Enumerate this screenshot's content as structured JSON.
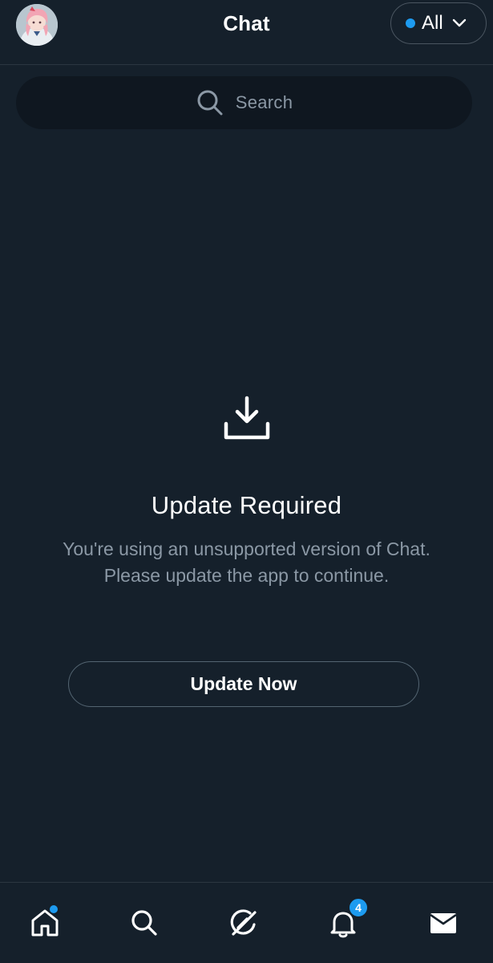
{
  "header": {
    "title": "Chat",
    "filter_label": "All"
  },
  "search": {
    "placeholder": "Search"
  },
  "empty_state": {
    "title": "Update Required",
    "body": "You're using an unsupported version of Chat. Please update the app to continue.",
    "button_label": "Update Now"
  },
  "bottom_nav": {
    "items": [
      {
        "name": "home",
        "icon": "home-icon"
      },
      {
        "name": "search",
        "icon": "search-icon"
      },
      {
        "name": "grok",
        "icon": "grok-icon"
      },
      {
        "name": "notifications",
        "icon": "bell-icon",
        "badge": "4"
      },
      {
        "name": "messages",
        "icon": "envelope-icon"
      }
    ]
  },
  "colors": {
    "background": "#15202b",
    "accent": "#1d9bf0",
    "muted_text": "#8b98a5",
    "divider": "#2b3640"
  }
}
